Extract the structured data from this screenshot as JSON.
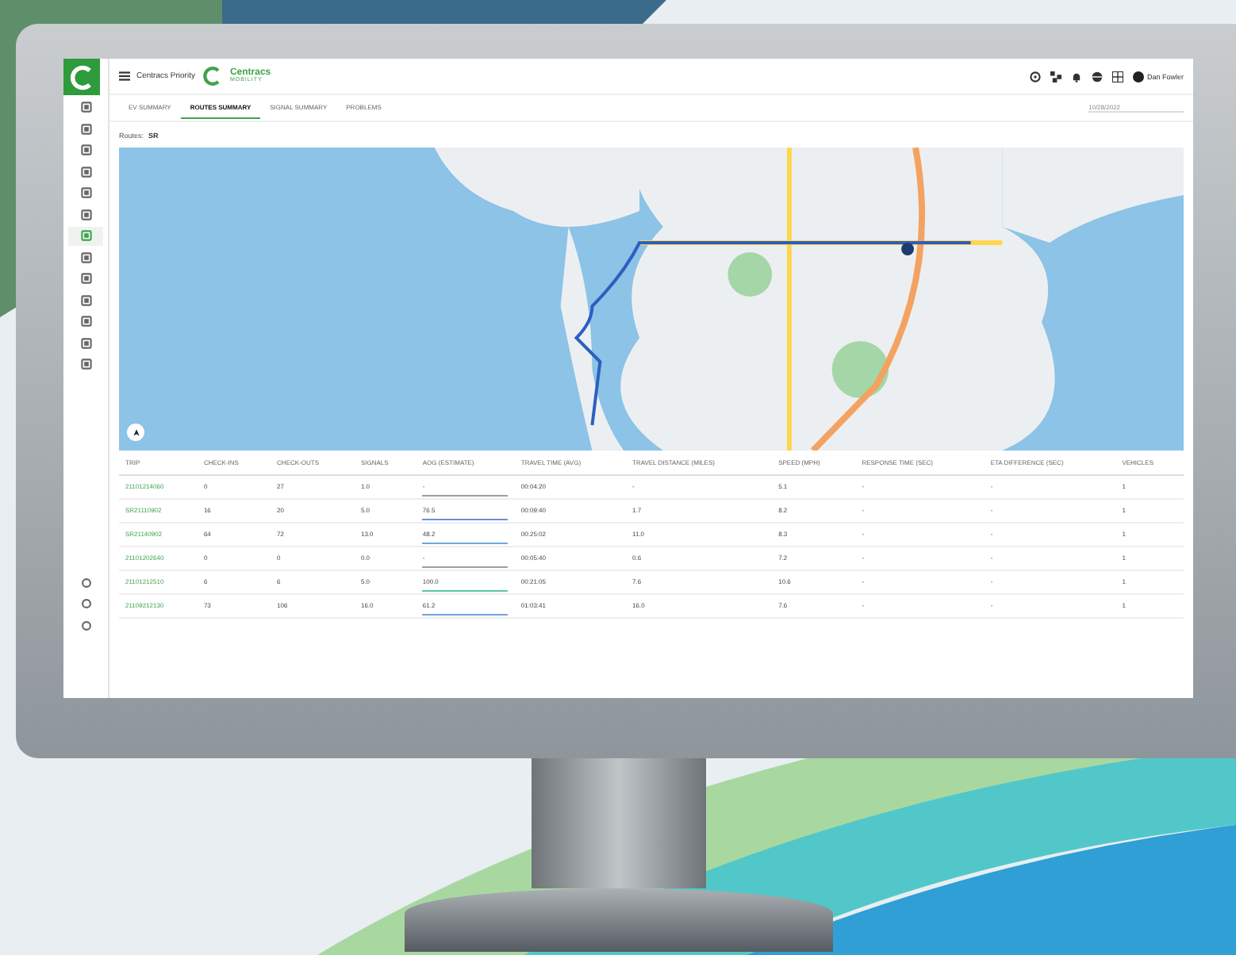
{
  "app": {
    "title": "Centracs Priority",
    "logo_name": "Centracs",
    "logo_tagline": "MOBILITY",
    "user": "Dan Fowler"
  },
  "sidebar": {
    "items": [
      {
        "selected": false
      },
      {
        "selected": false
      },
      {
        "selected": false
      },
      {
        "selected": false
      },
      {
        "selected": false
      },
      {
        "selected": false
      },
      {
        "selected": true
      },
      {
        "selected": false
      },
      {
        "selected": false
      },
      {
        "selected": false
      },
      {
        "selected": false
      },
      {
        "selected": false
      },
      {
        "selected": false
      }
    ],
    "bottom_items": [
      {
        "selected": false
      },
      {
        "selected": false
      },
      {
        "selected": false
      }
    ]
  },
  "tabs": [
    {
      "label": "EV SUMMARY",
      "selected": false
    },
    {
      "label": "ROUTES SUMMARY",
      "selected": true
    },
    {
      "label": "SIGNAL SUMMARY",
      "selected": false
    },
    {
      "label": "PROBLEMS",
      "selected": false
    }
  ],
  "date_field": {
    "value": "10/28/2022"
  },
  "filter": {
    "label": "Routes:",
    "value": "SR"
  },
  "table": {
    "columns": [
      "TRIP",
      "CHECK-INS",
      "CHECK-OUTS",
      "SIGNALS",
      "AOG (ESTIMATE)",
      "TRAVEL TIME (AVG)",
      "TRAVEL DISTANCE (MILES)",
      "SPEED (MPH)",
      "RESPONSE TIME (SEC)",
      "ETA DIFFERENCE (SEC)",
      "VEHICLES"
    ],
    "rows": [
      {
        "cells": [
          "21101214060",
          "0",
          "27",
          "1.0",
          "-",
          "00:04:20",
          "-",
          "5.1",
          "-",
          "-",
          "1"
        ],
        "color": "#9e9e9e"
      },
      {
        "cells": [
          "SR21110902",
          "16",
          "20",
          "5.0",
          "76.5",
          "00:09:40",
          "1.7",
          "8.2",
          "-",
          "-",
          "1"
        ],
        "color": "#6f8fd6"
      },
      {
        "cells": [
          "SR21140902",
          "64",
          "72",
          "13.0",
          "48.2",
          "00:25:02",
          "11.0",
          "8.3",
          "-",
          "-",
          "1"
        ],
        "color": "#6fa6e0"
      },
      {
        "cells": [
          "21101202640",
          "0",
          "0",
          "0.0",
          "-",
          "00:05:40",
          "0.6",
          "7.2",
          "-",
          "-",
          "1"
        ],
        "color": "#9e9e9e"
      },
      {
        "cells": [
          "21101212510",
          "6",
          "6",
          "5.0",
          "100.0",
          "00:21:05",
          "7.6",
          "10.6",
          "-",
          "-",
          "1"
        ],
        "color": "#5cc9a0"
      },
      {
        "cells": [
          "21109212130",
          "73",
          "106",
          "16.0",
          "61.2",
          "01:03:41",
          "16.0",
          "7.6",
          "-",
          "-",
          "1"
        ],
        "color": "#6fa6e0"
      }
    ]
  }
}
